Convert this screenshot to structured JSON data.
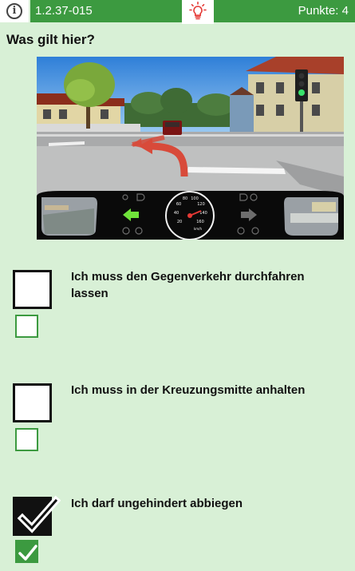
{
  "header": {
    "question_id": "1.2.37-015",
    "points_label": "Punkte: 4",
    "info_icon": "info-icon",
    "hint_icon": "lightbulb-icon",
    "accent_color": "#3c9a40",
    "hint_color": "#e53935"
  },
  "question": {
    "text": "Was gilt hier?",
    "image": "driver-view-intersection-left-turn"
  },
  "dashboard": {
    "speedometer_ticks": [
      "20",
      "40",
      "60",
      "80",
      "100",
      "120",
      "140",
      "160"
    ],
    "speed_unit": "km/h"
  },
  "answers": [
    {
      "text": "Ich muss den Gegenverkehr durchfahren lassen",
      "user_checked": false,
      "solution_checked": false
    },
    {
      "text": "Ich muss in der Kreuzungsmitte anhalten",
      "user_checked": false,
      "solution_checked": false
    },
    {
      "text": "Ich darf ungehindert abbiegen",
      "user_checked": true,
      "solution_checked": true
    }
  ]
}
